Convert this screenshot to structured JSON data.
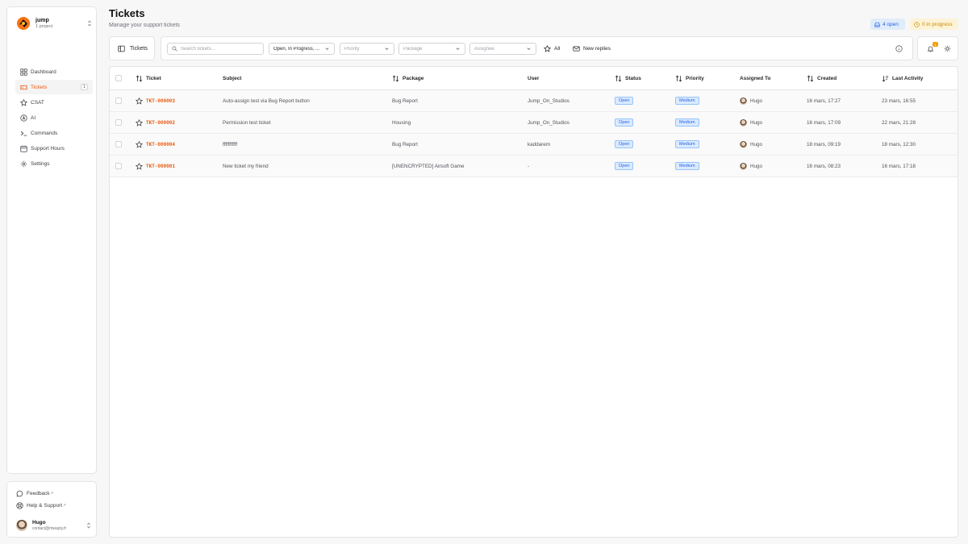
{
  "project": {
    "name": "jump",
    "subtitle": "1 project"
  },
  "nav": [
    {
      "label": "Dashboard",
      "icon": "dashboard-icon"
    },
    {
      "label": "Tickets",
      "icon": "ticket-icon",
      "badge": "1",
      "active": true
    },
    {
      "label": "CSAT",
      "icon": "star-icon"
    },
    {
      "label": "AI",
      "icon": "ai-icon"
    },
    {
      "label": "Commands",
      "icon": "terminal-icon"
    },
    {
      "label": "Support Hours",
      "icon": "calendar-icon"
    },
    {
      "label": "Settings",
      "icon": "gear-icon"
    }
  ],
  "footer": {
    "feedback": "Feedback",
    "help": "Help & Support",
    "user_name": "Hugo",
    "user_email": "contact@mwayty.fr"
  },
  "header": {
    "title": "Tickets",
    "subtitle": "Manage your support tickets",
    "open_pill": "4 open",
    "progress_pill": "0 in progress"
  },
  "toolbar": {
    "tab_label": "Tickets",
    "search_placeholder": "Search tickets...",
    "status_value": "Open, In Progress, ...",
    "priority_placeholder": "Priority",
    "package_placeholder": "Package",
    "assignee_placeholder": "Assignee",
    "all_label": "All",
    "new_replies_label": "New replies",
    "notification_count": "1"
  },
  "table": {
    "columns": {
      "ticket": "Ticket",
      "subject": "Subject",
      "package": "Package",
      "user": "User",
      "status": "Status",
      "priority": "Priority",
      "assigned": "Assigned To",
      "created": "Created",
      "activity": "Last Activity"
    },
    "rows": [
      {
        "id": "TKT-000003",
        "subject": "Auto-assign test via Bug Report button",
        "package": "Bug Report",
        "user": "Jump_On_Studios",
        "status": "Open",
        "priority": "Medium",
        "assignee": "Hugo",
        "created": "16 mars, 17:27",
        "activity": "23 mars, 16:55"
      },
      {
        "id": "TKT-000002",
        "subject": "Permission test ticket",
        "package": "Housing",
        "user": "Jump_On_Studios",
        "status": "Open",
        "priority": "Medium",
        "assignee": "Hugo",
        "created": "16 mars, 17:09",
        "activity": "22 mars, 21:28"
      },
      {
        "id": "TKT-000004",
        "subject": "fffffffffff",
        "package": "Bug Report",
        "user": "kaddarem",
        "status": "Open",
        "priority": "Medium",
        "assignee": "Hugo",
        "created": "18 mars, 09:19",
        "activity": "18 mars, 12:30"
      },
      {
        "id": "TKT-000001",
        "subject": "New ticket my friend",
        "package": "[UNENCRYPTED] Airsoft Game",
        "user": "-",
        "status": "Open",
        "priority": "Medium",
        "assignee": "Hugo",
        "created": "16 mars, 08:23",
        "activity": "16 mars, 17:18"
      }
    ]
  },
  "colors": {
    "accent": "#ea580c",
    "badge_blue": "#2563eb",
    "badge_blue_bg": "#dbeafe",
    "progress_yellow": "#ca8a04"
  }
}
